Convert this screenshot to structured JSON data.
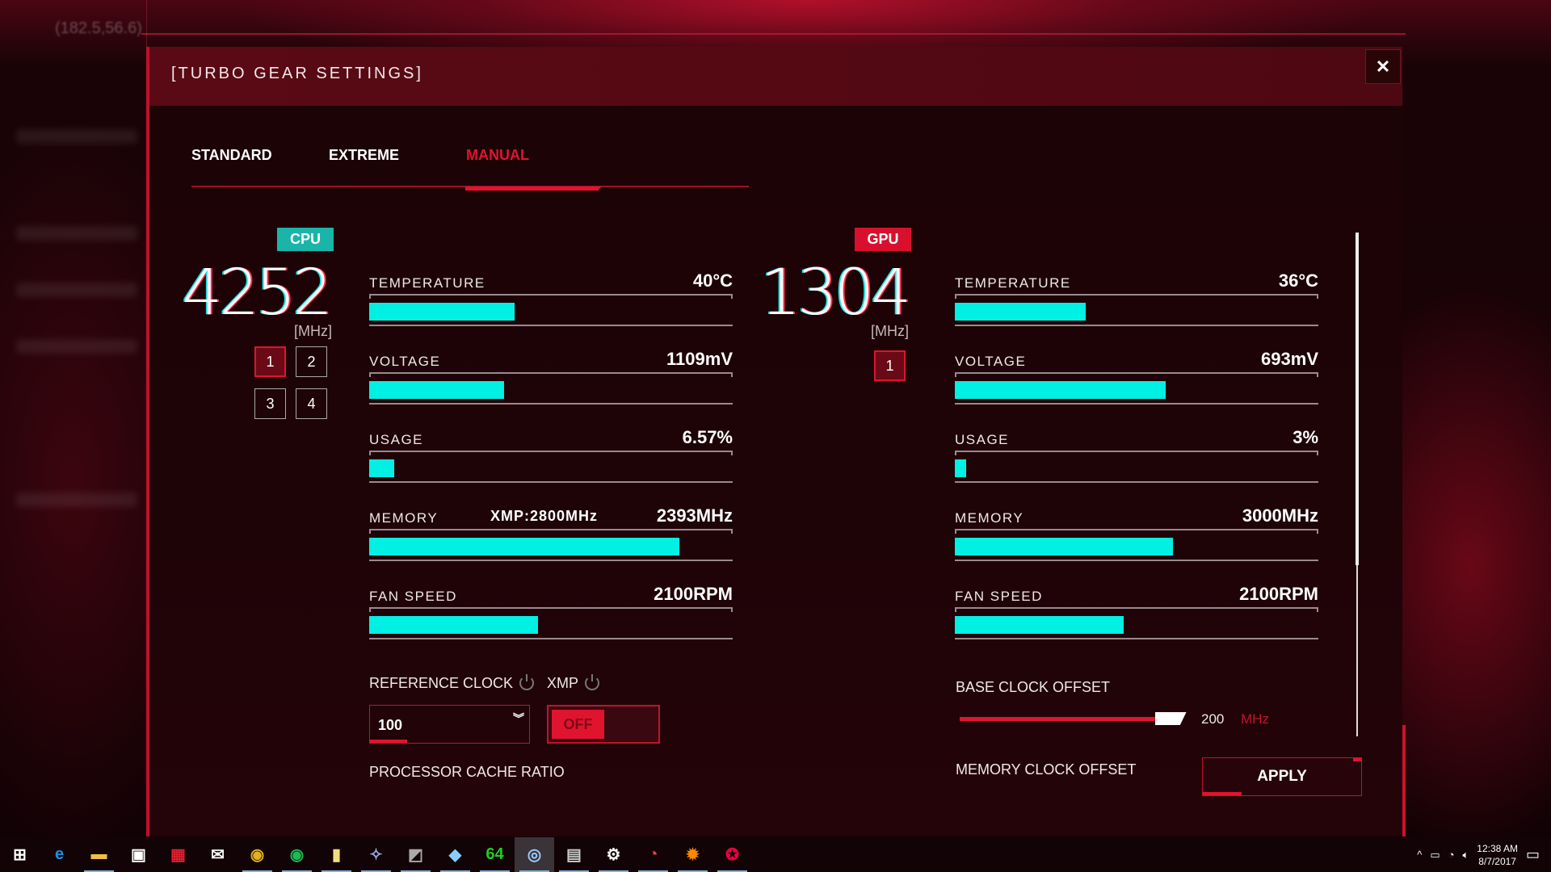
{
  "background": {
    "coords_text": "(182.5,56.6)"
  },
  "dialog": {
    "title": "[TURBO GEAR SETTINGS]",
    "close_icon": "close-icon"
  },
  "tabs": [
    {
      "label": "STANDARD",
      "active": false
    },
    {
      "label": "EXTREME",
      "active": false
    },
    {
      "label": "MANUAL",
      "active": true
    }
  ],
  "colors": {
    "accent": "#e0142e",
    "cpu": "#1ab5a8",
    "gpu": "#d8102e",
    "bar": "#00f0e4"
  },
  "cpu": {
    "badge": "CPU",
    "frequency": "4252",
    "unit": "[MHz]",
    "cores": [
      "1",
      "2",
      "3",
      "4"
    ],
    "active_core": "1",
    "metrics": [
      {
        "label": "TEMPERATURE",
        "value": "40°C",
        "fill": 0.4
      },
      {
        "label": "VOLTAGE",
        "value": "1109mV",
        "fill": 0.37
      },
      {
        "label": "USAGE",
        "value": "6.57%",
        "fill": 0.068
      },
      {
        "label": "MEMORY",
        "sub": "XMP:2800MHz",
        "value": "2393MHz",
        "fill": 0.853
      },
      {
        "label": "FAN SPEED",
        "value": "2100RPM",
        "fill": 0.465
      }
    ]
  },
  "gpu": {
    "badge": "GPU",
    "frequency": "1304",
    "unit": "[MHz]",
    "cores": [
      "1"
    ],
    "active_core": "1",
    "metrics": [
      {
        "label": "TEMPERATURE",
        "value": "36°C",
        "fill": 0.36
      },
      {
        "label": "VOLTAGE",
        "value": "693mV",
        "fill": 0.58
      },
      {
        "label": "USAGE",
        "value": "3%",
        "fill": 0.03
      },
      {
        "label": "MEMORY",
        "value": "3000MHz",
        "fill": 0.6
      },
      {
        "label": "FAN SPEED",
        "value": "2100RPM",
        "fill": 0.465
      }
    ]
  },
  "controls": {
    "reference_clock_label": "REFERENCE CLOCK",
    "reference_clock_value": "100",
    "xmp_label": "XMP",
    "xmp_state": "OFF",
    "processor_cache_ratio_label": "PROCESSOR CACHE RATIO",
    "base_clock_offset_label": "BASE CLOCK OFFSET",
    "base_clock_offset_value": "200",
    "base_clock_offset_unit": "MHz",
    "base_clock_offset_fraction": 0.87,
    "memory_clock_offset_label": "MEMORY CLOCK OFFSET",
    "apply_label": "APPLY"
  },
  "taskbar": {
    "icons": [
      {
        "name": "windows-start",
        "glyph": "⊞",
        "color": "#fff"
      },
      {
        "name": "edge",
        "glyph": "e",
        "color": "#1e90e0"
      },
      {
        "name": "file-explorer",
        "glyph": "▬",
        "color": "#f0c040"
      },
      {
        "name": "store",
        "glyph": "▣",
        "color": "#fff"
      },
      {
        "name": "gift",
        "glyph": "▦",
        "color": "#e02030"
      },
      {
        "name": "mail",
        "glyph": "✉",
        "color": "#fff"
      },
      {
        "name": "chrome",
        "glyph": "◉",
        "color": "#e0b020"
      },
      {
        "name": "spotify",
        "glyph": "◉",
        "color": "#1db954"
      },
      {
        "name": "sticky-notes",
        "glyph": "▮",
        "color": "#f0e080"
      },
      {
        "name": "app-bird",
        "glyph": "✧",
        "color": "#9ad"
      },
      {
        "name": "app-gauge",
        "glyph": "◩",
        "color": "#aaa"
      },
      {
        "name": "app-blue",
        "glyph": "◆",
        "color": "#8cf"
      },
      {
        "name": "aida64",
        "glyph": "64",
        "color": "#2c2"
      },
      {
        "name": "steam",
        "glyph": "◎",
        "color": "#9cf"
      },
      {
        "name": "app-device",
        "glyph": "▤",
        "color": "#ccc"
      },
      {
        "name": "settings",
        "glyph": "⚙",
        "color": "#fff"
      },
      {
        "name": "app-red-gauge",
        "glyph": "◔",
        "color": "#e44"
      },
      {
        "name": "app-flame",
        "glyph": "✹",
        "color": "#f80"
      },
      {
        "name": "rog-gaming-center",
        "glyph": "✪",
        "color": "#e04"
      }
    ],
    "active_icon": "steam",
    "time": "12:38 AM",
    "date": "8/7/2017"
  }
}
